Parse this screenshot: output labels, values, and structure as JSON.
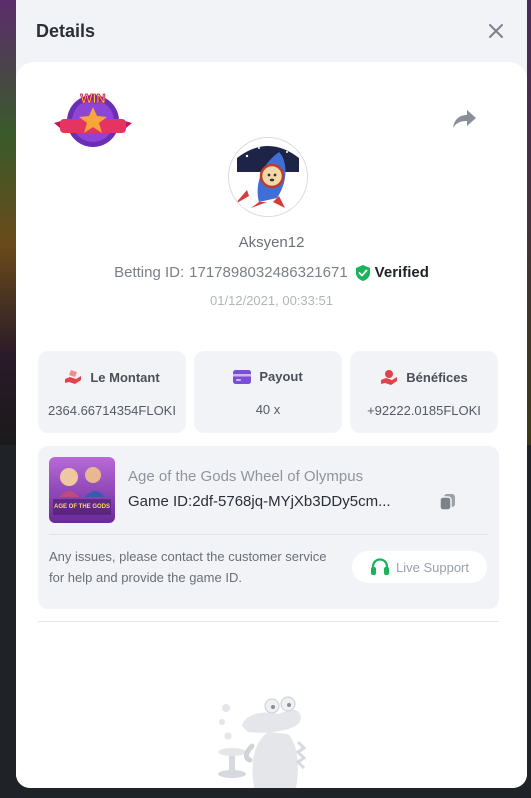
{
  "modal": {
    "title": "Details"
  },
  "bet": {
    "username": "Aksyen12",
    "betting_id_label": "Betting ID:",
    "betting_id": "1717898032486321671",
    "verified_label": "Verified",
    "timestamp": "01/12/2021, 00:33:51"
  },
  "stats": [
    {
      "label": "Le Montant",
      "value": "2364.66714354FLOKI",
      "icon": "money-hand-icon"
    },
    {
      "label": "Payout",
      "value": "40 x",
      "icon": "card-icon"
    },
    {
      "label": "Bénéfices",
      "value": "+92222.0185FLOKI",
      "icon": "profit-hand-icon"
    }
  ],
  "game": {
    "name": "Age of the Gods Wheel of Olympus",
    "id_label": "Game ID:",
    "id_value": "2df-5768jq-MYjXb3DDy5cm...",
    "thumbnail_text": "AGE OF THE GODS"
  },
  "support": {
    "message": "Any issues, please contact the customer service for help and provide the game ID.",
    "button_label": "Live Support"
  },
  "colors": {
    "accent_green": "#19b35a",
    "stat_icon_red": "#e0434b",
    "stat_icon_purple": "#7a4fd6",
    "panel_bg": "#f2f3f7"
  }
}
